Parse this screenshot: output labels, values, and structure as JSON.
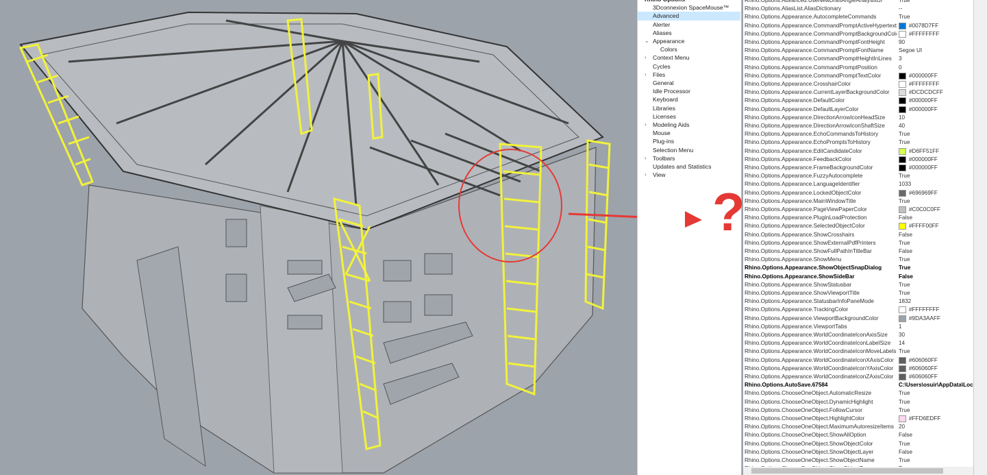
{
  "tree": {
    "items": [
      {
        "label": "Rhino Options",
        "level": 0,
        "chev": "",
        "bold": true
      },
      {
        "label": "3Dconnexion SpaceMouse™",
        "level": 1,
        "chev": ""
      },
      {
        "label": "Advanced",
        "level": 1,
        "chev": "",
        "selected": true
      },
      {
        "label": "Alerter",
        "level": 1,
        "chev": ""
      },
      {
        "label": "Aliases",
        "level": 1,
        "chev": ""
      },
      {
        "label": "Appearance",
        "level": 1,
        "chev": "⌄"
      },
      {
        "label": "Colors",
        "level": 2,
        "chev": ""
      },
      {
        "label": "Context Menu",
        "level": 1,
        "chev": "›"
      },
      {
        "label": "Cycles",
        "level": 1,
        "chev": ""
      },
      {
        "label": "Files",
        "level": 1,
        "chev": "›"
      },
      {
        "label": "General",
        "level": 1,
        "chev": ""
      },
      {
        "label": "Idle Processor",
        "level": 1,
        "chev": ""
      },
      {
        "label": "Keyboard",
        "level": 1,
        "chev": ""
      },
      {
        "label": "Libraries",
        "level": 1,
        "chev": ""
      },
      {
        "label": "Licenses",
        "level": 1,
        "chev": ""
      },
      {
        "label": "Modeling Aids",
        "level": 1,
        "chev": "›"
      },
      {
        "label": "Mouse",
        "level": 1,
        "chev": ""
      },
      {
        "label": "Plug-ins",
        "level": 1,
        "chev": ""
      },
      {
        "label": "Selection Menu",
        "level": 1,
        "chev": ""
      },
      {
        "label": "Toolbars",
        "level": 1,
        "chev": "›"
      },
      {
        "label": "Updates and Statistics",
        "level": 1,
        "chev": ""
      },
      {
        "label": "View",
        "level": 1,
        "chev": "›"
      }
    ]
  },
  "settings": [
    [
      "Rhino.Options.Advanced.UseNewDraftAngleAnalysisUI",
      "True"
    ],
    [
      "Rhino.Options.AliasList.AliasDictionary",
      "--"
    ],
    [
      "Rhino.Options.Appearance.AutocompleteCommands",
      "True"
    ],
    [
      "Rhino.Options.Appearance.CommandPromptActiveHypertextColor",
      "#0078D7FF",
      "#0078D7"
    ],
    [
      "Rhino.Options.Appearance.CommandPromptBackgroundColor",
      "#FFFFFFFF",
      "#FFFFFF"
    ],
    [
      "Rhino.Options.Appearance.CommandPromptFontHeight",
      "90"
    ],
    [
      "Rhino.Options.Appearance.CommandPromptFontName",
      "Segoe UI"
    ],
    [
      "Rhino.Options.Appearance.CommandPromptHeightInLines",
      "3"
    ],
    [
      "Rhino.Options.Appearance.CommandPromptPosition",
      "0"
    ],
    [
      "Rhino.Options.Appearance.CommandPromptTextColor",
      "#000000FF",
      "#000000"
    ],
    [
      "Rhino.Options.Appearance.CrosshairColor",
      "#FFFFFFFF",
      "#FFFFFF"
    ],
    [
      "Rhino.Options.Appearance.CurrentLayerBackgroundColor",
      "#DCDCDCFF",
      "#DCDCDC"
    ],
    [
      "Rhino.Options.Appearance.DefaultColor",
      "#000000FF",
      "#000000"
    ],
    [
      "Rhino.Options.Appearance.DefaultLayerColor",
      "#000000FF",
      "#000000"
    ],
    [
      "Rhino.Options.Appearance.DirectionArrowIconHeadSize",
      "10"
    ],
    [
      "Rhino.Options.Appearance.DirectionArrowIconShaftSize",
      "40"
    ],
    [
      "Rhino.Options.Appearance.EchoCommandsToHistory",
      "True"
    ],
    [
      "Rhino.Options.Appearance.EchoPromptsToHistory",
      "True"
    ],
    [
      "Rhino.Options.Appearance.EditCandidateColor",
      "#D6FF51FF",
      "#D6FF51"
    ],
    [
      "Rhino.Options.Appearance.FeedbackColor",
      "#000000FF",
      "#000000"
    ],
    [
      "Rhino.Options.Appearance.FrameBackgroundColor",
      "#000000FF",
      "#000000"
    ],
    [
      "Rhino.Options.Appearance.FuzzyAutocomplete",
      "True"
    ],
    [
      "Rhino.Options.Appearance.LanguageIdentifier",
      "1033"
    ],
    [
      "Rhino.Options.Appearance.LockedObjectColor",
      "#696969FF",
      "#696969"
    ],
    [
      "Rhino.Options.Appearance.MainWindowTitle",
      "True"
    ],
    [
      "Rhino.Options.Appearance.PageViewPaperColor",
      "#C0C0C0FF",
      "#C0C0C0"
    ],
    [
      "Rhino.Options.Appearance.PluginLoadProtection",
      "False"
    ],
    [
      "Rhino.Options.Appearance.SelectedObjectColor",
      "#FFFF00FF",
      "#FFFF00"
    ],
    [
      "Rhino.Options.Appearance.ShowCrosshairs",
      "False"
    ],
    [
      "Rhino.Options.Appearance.ShowExternalPdfPrinters",
      "True"
    ],
    [
      "Rhino.Options.Appearance.ShowFullPathInTitleBar",
      "False"
    ],
    [
      "Rhino.Options.Appearance.ShowMenu",
      "True"
    ],
    [
      "Rhino.Options.Appearance.ShowObjectSnapDialog",
      "True",
      null,
      true
    ],
    [
      "Rhino.Options.Appearance.ShowSideBar",
      "False",
      null,
      true
    ],
    [
      "Rhino.Options.Appearance.ShowStatusbar",
      "True"
    ],
    [
      "Rhino.Options.Appearance.ShowViewportTitle",
      "True"
    ],
    [
      "Rhino.Options.Appearance.StatusbarInfoPaneMode",
      "1832"
    ],
    [
      "Rhino.Options.Appearance.TrackingColor",
      "#FFFFFFFF",
      "#FFFFFF"
    ],
    [
      "Rhino.Options.Appearance.ViewportBackgroundColor",
      "#9DA3AAFF",
      "#9DA3AA"
    ],
    [
      "Rhino.Options.Appearance.ViewportTabs",
      "1"
    ],
    [
      "Rhino.Options.Appearance.WorldCoordinateIconAxisSize",
      "30"
    ],
    [
      "Rhino.Options.Appearance.WorldCoordinateIconLabelSize",
      "14"
    ],
    [
      "Rhino.Options.Appearance.WorldCoordinateIconMoveLabels",
      "True"
    ],
    [
      "Rhino.Options.Appearance.WorldCoordinateIconXAxisColor",
      "#606060FF",
      "#606060"
    ],
    [
      "Rhino.Options.Appearance.WorldCoordinateIconYAxisColor",
      "#606060FF",
      "#606060"
    ],
    [
      "Rhino.Options.Appearance.WorldCoordinateIconZAxisColor",
      "#606060FF",
      "#606060"
    ],
    [
      "Rhino.Options.AutoSave.67584",
      "C:\\Users\\osuir\\AppData\\Local",
      null,
      true
    ],
    [
      "Rhino.Options.ChooseOneObject.AutomaticResize",
      "True"
    ],
    [
      "Rhino.Options.ChooseOneObject.DynamicHighlight",
      "True"
    ],
    [
      "Rhino.Options.ChooseOneObject.FollowCursor",
      "True"
    ],
    [
      "Rhino.Options.ChooseOneObject.HighlightColor",
      "#FFD6EDFF",
      "#FFD6ED"
    ],
    [
      "Rhino.Options.ChooseOneObject.MaximumAutoresizeItems",
      "20"
    ],
    [
      "Rhino.Options.ChooseOneObject.ShowAllOption",
      "False"
    ],
    [
      "Rhino.Options.ChooseOneObject.ShowObjectColor",
      "True"
    ],
    [
      "Rhino.Options.ChooseOneObject.ShowObjectLayer",
      "False"
    ],
    [
      "Rhino.Options.ChooseOneObject.ShowObjectName",
      "True"
    ],
    [
      "Rhino.Options.ChooseOneObject.ShowObjectType",
      "True"
    ]
  ],
  "annotation": {
    "question_mark": "?",
    "color": "#e53935"
  },
  "colors": {
    "viewport_bg": "#9da3aa",
    "scaffold": "#f2f23a"
  }
}
